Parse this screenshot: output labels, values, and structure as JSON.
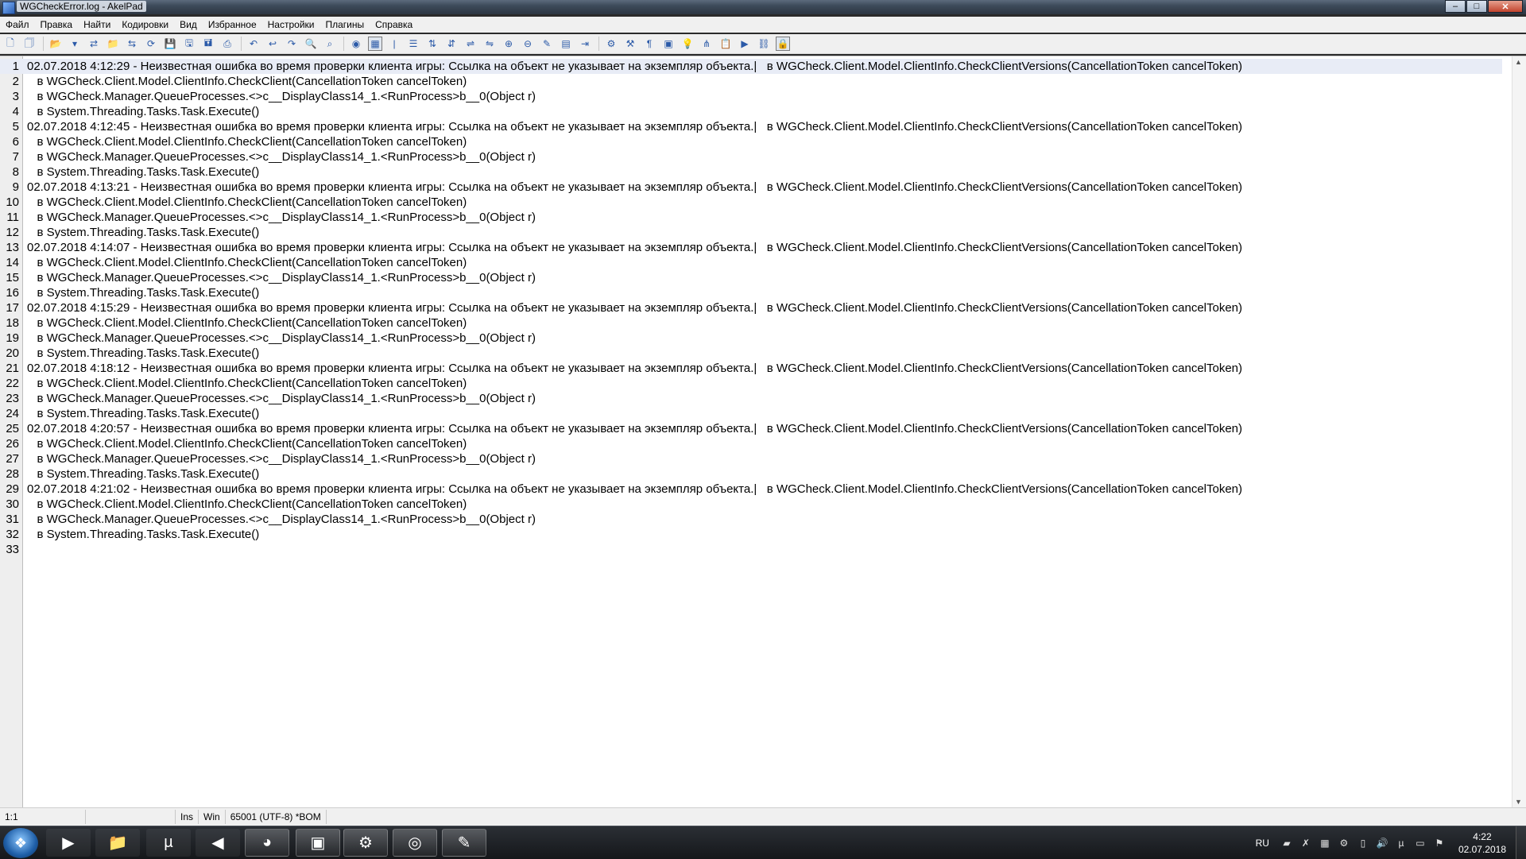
{
  "window": {
    "title": "WGCheckError.log - AkelPad",
    "minimize": "–",
    "maximize": "□",
    "close": "✕"
  },
  "menu": [
    "Файл",
    "Правка",
    "Найти",
    "Кодировки",
    "Вид",
    "Избранное",
    "Настройки",
    "Плагины",
    "Справка"
  ],
  "toolbar": {
    "icons": [
      {
        "name": "new-file-icon",
        "glyph": "🗋"
      },
      {
        "name": "new-window-icon",
        "glyph": "🗍"
      },
      {
        "name": "open-folder-icon",
        "glyph": "📂"
      },
      {
        "name": "open-dropdown-icon",
        "glyph": "▾"
      },
      {
        "name": "open-recent-icon",
        "glyph": "⇄"
      },
      {
        "name": "open-file-icon",
        "glyph": "📁"
      },
      {
        "name": "reopen-icon",
        "glyph": "⇆"
      },
      {
        "name": "reload-icon",
        "glyph": "⟳"
      },
      {
        "name": "save-icon",
        "glyph": "💾"
      },
      {
        "name": "save-as-icon",
        "glyph": "🖫"
      },
      {
        "name": "save-all-icon",
        "glyph": "🖬"
      },
      {
        "name": "print-icon",
        "glyph": "⎙"
      },
      {
        "name": "undo-icon",
        "glyph": "↶"
      },
      {
        "name": "undo-alt-icon",
        "glyph": "↩"
      },
      {
        "name": "redo-icon",
        "glyph": "↷"
      },
      {
        "name": "find-icon",
        "glyph": "🔍"
      },
      {
        "name": "replace-icon",
        "glyph": "⌕"
      },
      {
        "name": "record-icon",
        "glyph": "◉"
      },
      {
        "name": "column-select-icon",
        "glyph": "▦"
      },
      {
        "name": "caret-icon",
        "glyph": "|"
      },
      {
        "name": "list-icon",
        "glyph": "☰"
      },
      {
        "name": "sort-asc-icon",
        "glyph": "⇅"
      },
      {
        "name": "sort-desc-icon",
        "glyph": "⇵"
      },
      {
        "name": "convert-icon",
        "glyph": "⇌"
      },
      {
        "name": "swap-icon",
        "glyph": "⇋"
      },
      {
        "name": "zoom-in-icon",
        "glyph": "⊕"
      },
      {
        "name": "zoom-out-icon",
        "glyph": "⊖"
      },
      {
        "name": "highlight-icon",
        "glyph": "✎"
      },
      {
        "name": "table-icon",
        "glyph": "▤"
      },
      {
        "name": "wrap-icon",
        "glyph": "⇥"
      },
      {
        "name": "settings-icon",
        "glyph": "⚙"
      },
      {
        "name": "plugins-icon",
        "glyph": "⚒"
      },
      {
        "name": "pilcrow-icon",
        "glyph": "¶"
      },
      {
        "name": "hex-icon",
        "glyph": "▣"
      },
      {
        "name": "bulb-icon",
        "glyph": "💡"
      },
      {
        "name": "tree-icon",
        "glyph": "⋔"
      },
      {
        "name": "clipboard-icon",
        "glyph": "📋"
      },
      {
        "name": "run-icon",
        "glyph": "▶"
      },
      {
        "name": "link-icon",
        "glyph": "⛓"
      },
      {
        "name": "lock-icon",
        "glyph": "🔒"
      }
    ]
  },
  "editor": {
    "lines": [
      {
        "n": "1",
        "t": "02.07.2018 4:12:29 - Неизвестная ошибка во время проверки клиента игры: Ссылка на объект не указывает на экземпляр объекта.|   в WGCheck.Client.Model.ClientInfo.CheckClientVersions(CancellationToken cancelToken)"
      },
      {
        "n": "2",
        "t": "   в WGCheck.Client.Model.ClientInfo.CheckClient(CancellationToken cancelToken)"
      },
      {
        "n": "3",
        "t": "   в WGCheck.Manager.QueueProcesses.<>c__DisplayClass14_1.<RunProcess>b__0(Object r)"
      },
      {
        "n": "4",
        "t": "   в System.Threading.Tasks.Task.Execute()"
      },
      {
        "n": "5",
        "t": "02.07.2018 4:12:45 - Неизвестная ошибка во время проверки клиента игры: Ссылка на объект не указывает на экземпляр объекта.|   в WGCheck.Client.Model.ClientInfo.CheckClientVersions(CancellationToken cancelToken)"
      },
      {
        "n": "6",
        "t": "   в WGCheck.Client.Model.ClientInfo.CheckClient(CancellationToken cancelToken)"
      },
      {
        "n": "7",
        "t": "   в WGCheck.Manager.QueueProcesses.<>c__DisplayClass14_1.<RunProcess>b__0(Object r)"
      },
      {
        "n": "8",
        "t": "   в System.Threading.Tasks.Task.Execute()"
      },
      {
        "n": "9",
        "t": "02.07.2018 4:13:21 - Неизвестная ошибка во время проверки клиента игры: Ссылка на объект не указывает на экземпляр объекта.|   в WGCheck.Client.Model.ClientInfo.CheckClientVersions(CancellationToken cancelToken)"
      },
      {
        "n": "10",
        "t": "   в WGCheck.Client.Model.ClientInfo.CheckClient(CancellationToken cancelToken)"
      },
      {
        "n": "11",
        "t": "   в WGCheck.Manager.QueueProcesses.<>c__DisplayClass14_1.<RunProcess>b__0(Object r)"
      },
      {
        "n": "12",
        "t": "   в System.Threading.Tasks.Task.Execute()"
      },
      {
        "n": "13",
        "t": "02.07.2018 4:14:07 - Неизвестная ошибка во время проверки клиента игры: Ссылка на объект не указывает на экземпляр объекта.|   в WGCheck.Client.Model.ClientInfo.CheckClientVersions(CancellationToken cancelToken)"
      },
      {
        "n": "14",
        "t": "   в WGCheck.Client.Model.ClientInfo.CheckClient(CancellationToken cancelToken)"
      },
      {
        "n": "15",
        "t": "   в WGCheck.Manager.QueueProcesses.<>c__DisplayClass14_1.<RunProcess>b__0(Object r)"
      },
      {
        "n": "16",
        "t": "   в System.Threading.Tasks.Task.Execute()"
      },
      {
        "n": "17",
        "t": "02.07.2018 4:15:29 - Неизвестная ошибка во время проверки клиента игры: Ссылка на объект не указывает на экземпляр объекта.|   в WGCheck.Client.Model.ClientInfo.CheckClientVersions(CancellationToken cancelToken)"
      },
      {
        "n": "18",
        "t": "   в WGCheck.Client.Model.ClientInfo.CheckClient(CancellationToken cancelToken)"
      },
      {
        "n": "19",
        "t": "   в WGCheck.Manager.QueueProcesses.<>c__DisplayClass14_1.<RunProcess>b__0(Object r)"
      },
      {
        "n": "20",
        "t": "   в System.Threading.Tasks.Task.Execute()"
      },
      {
        "n": "21",
        "t": "02.07.2018 4:18:12 - Неизвестная ошибка во время проверки клиента игры: Ссылка на объект не указывает на экземпляр объекта.|   в WGCheck.Client.Model.ClientInfo.CheckClientVersions(CancellationToken cancelToken)"
      },
      {
        "n": "22",
        "t": "   в WGCheck.Client.Model.ClientInfo.CheckClient(CancellationToken cancelToken)"
      },
      {
        "n": "23",
        "t": "   в WGCheck.Manager.QueueProcesses.<>c__DisplayClass14_1.<RunProcess>b__0(Object r)"
      },
      {
        "n": "24",
        "t": "   в System.Threading.Tasks.Task.Execute()"
      },
      {
        "n": "25",
        "t": "02.07.2018 4:20:57 - Неизвестная ошибка во время проверки клиента игры: Ссылка на объект не указывает на экземпляр объекта.|   в WGCheck.Client.Model.ClientInfo.CheckClientVersions(CancellationToken cancelToken)"
      },
      {
        "n": "26",
        "t": "   в WGCheck.Client.Model.ClientInfo.CheckClient(CancellationToken cancelToken)"
      },
      {
        "n": "27",
        "t": "   в WGCheck.Manager.QueueProcesses.<>c__DisplayClass14_1.<RunProcess>b__0(Object r)"
      },
      {
        "n": "28",
        "t": "   в System.Threading.Tasks.Task.Execute()"
      },
      {
        "n": "29",
        "t": "02.07.2018 4:21:02 - Неизвестная ошибка во время проверки клиента игры: Ссылка на объект не указывает на экземпляр объекта.|   в WGCheck.Client.Model.ClientInfo.CheckClientVersions(CancellationToken cancelToken)"
      },
      {
        "n": "30",
        "t": "   в WGCheck.Client.Model.ClientInfo.CheckClient(CancellationToken cancelToken)"
      },
      {
        "n": "31",
        "t": "   в WGCheck.Manager.QueueProcesses.<>c__DisplayClass14_1.<RunProcess>b__0(Object r)"
      },
      {
        "n": "32",
        "t": "   в System.Threading.Tasks.Task.Execute()"
      },
      {
        "n": "33",
        "t": ""
      }
    ]
  },
  "statusbar": {
    "position": "1:1",
    "mode": "Ins",
    "newline": "Win",
    "encoding": "65001 (UTF-8)  *BOM"
  },
  "taskbar": {
    "start_glyph": "❖",
    "apps": [
      {
        "name": "media-player-icon",
        "glyph": "▶",
        "state": "pinned"
      },
      {
        "name": "explorer-icon",
        "glyph": "📁",
        "state": "pinned"
      },
      {
        "name": "utorrent-icon",
        "glyph": "µ",
        "state": "pinned"
      },
      {
        "name": "media-classic-icon",
        "glyph": "◀",
        "state": "pinned"
      },
      {
        "name": "firefox-icon",
        "glyph": "◕",
        "state": "running"
      },
      {
        "name": "terminal-icon",
        "glyph": "▣",
        "state": "running"
      },
      {
        "name": "steam-icon",
        "glyph": "⚙",
        "state": "running"
      },
      {
        "name": "game-client-icon",
        "glyph": "◎",
        "state": "running"
      },
      {
        "name": "akelpad-icon",
        "glyph": "✎",
        "state": "running"
      }
    ],
    "lang": "RU",
    "tray_icons": [
      {
        "name": "nvidia-icon",
        "glyph": "▰"
      },
      {
        "name": "antivirus-icon",
        "glyph": "✗"
      },
      {
        "name": "monitor-icon",
        "glyph": "▦"
      },
      {
        "name": "steam-tray-icon",
        "glyph": "⚙"
      },
      {
        "name": "network-icon",
        "glyph": "▯"
      },
      {
        "name": "volume-icon",
        "glyph": "🔊"
      },
      {
        "name": "utorrent-tray-icon",
        "glyph": "µ"
      },
      {
        "name": "display-icon",
        "glyph": "▭"
      },
      {
        "name": "flag-icon",
        "glyph": "⚑"
      }
    ],
    "time": "4:22",
    "date": "02.07.2018"
  }
}
